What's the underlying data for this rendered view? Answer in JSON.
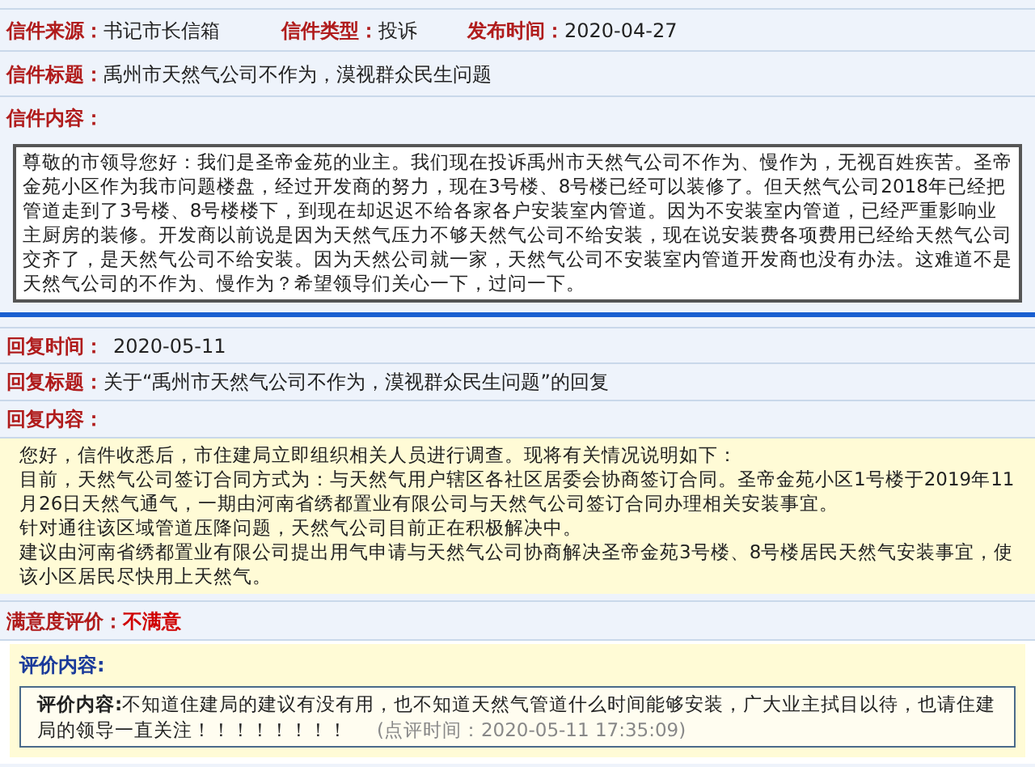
{
  "letter": {
    "meta": [
      {
        "label": "信件来源：",
        "value": "书记市长信箱"
      },
      {
        "label": "信件类型：",
        "value": "投诉"
      },
      {
        "label": "发布时间：",
        "value": "2020-04-27"
      }
    ],
    "title": {
      "label": "信件标题：",
      "value": "禹州市天然气公司不作为，漠视群众民生问题"
    },
    "content_label": "信件内容：",
    "content": "尊敬的市领导您好：我们是圣帝金苑的业主。我们现在投诉禹州市天然气公司不作为、慢作为，无视百姓疾苦。圣帝金苑小区作为我市问题楼盘，经过开发商的努力，现在3号楼、8号楼已经可以装修了。但天然气公司2018年已经把管道走到了3号楼、8号楼楼下，到现在却迟迟不给各家各户安装室内管道。因为不安装室内管道，已经严重影响业主厨房的装修。开发商以前说是因为天然气压力不够天然气公司不给安装，现在说安装费各项费用已经给天然气公司交齐了，是天然气公司不给安装。因为天然公司就一家，天然气公司不安装室内管道开发商也没有办法。这难道不是天然气公司的不作为、慢作为？希望领导们关心一下，过问一下。"
  },
  "reply": {
    "time": {
      "label": "回复时间：",
      "value": "2020-05-11"
    },
    "title": {
      "label": "回复标题：",
      "value": "关于“禹州市天然气公司不作为，漠视群众民生问题”的回复"
    },
    "content_label": "回复内容：",
    "paragraphs": [
      "您好，信件收悉后，市住建局立即组织相关人员进行调查。现将有关情况说明如下：",
      "目前，天然气公司签订合同方式为：与天然气用户辖区各社区居委会协商签订合同。圣帝金苑小区1号楼于2019年11月26日天然气通气，一期由河南省绣都置业有限公司与天然气公司签订合同办理相关安装事宜。",
      "针对通往该区域管道压降问题，天然气公司目前正在积极解决中。",
      "建议由河南省绣都置业有限公司提出用气申请与天然气公司协商解决圣帝金苑3号楼、8号楼居民天然气安装事宜，使该小区居民尽快用上天然气。"
    ]
  },
  "satisfaction": {
    "label": "满意度评价：",
    "value": "不满意"
  },
  "evaluation": {
    "heading": "评价内容:",
    "label": "评价内容:",
    "text": "不知道住建局的建议有没有用，也不知道天然气管道什么时间能够安装，广大业主拭目以待，也请住建局的领导一直关注！！！！！！！！",
    "time": "(点评时间：2020-05-11 17:35:09)"
  }
}
